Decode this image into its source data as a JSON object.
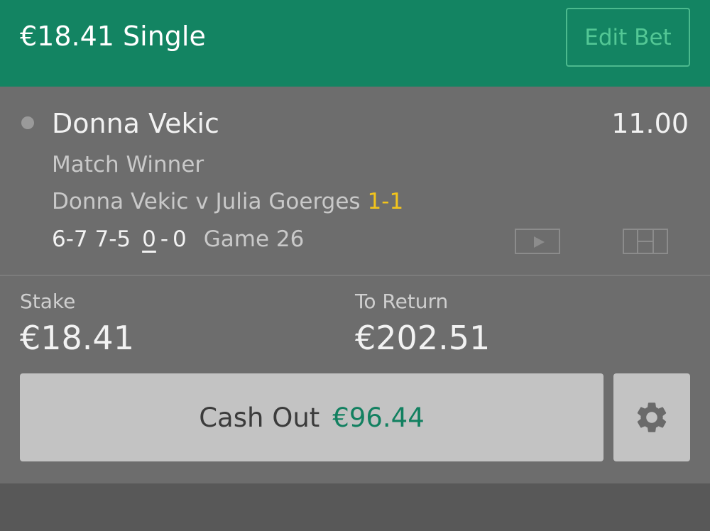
{
  "header": {
    "title": "€18.41 Single",
    "edit_label": "Edit Bet"
  },
  "selection": {
    "name": "Donna Vekic",
    "odds": "11.00",
    "market": "Match Winner",
    "event": "Donna Vekic v Julia Goerges",
    "set_score": "1-1",
    "score": {
      "sets": "6-7 7-5",
      "home_game": "0",
      "separator": "-",
      "away_game": "0",
      "game": "Game 26"
    },
    "icons": [
      "play-video-icon",
      "scoreboard-grid-icon"
    ]
  },
  "stake": {
    "stake_label": "Stake",
    "stake_value": "€18.41",
    "return_label": "To Return",
    "return_value": "€202.51"
  },
  "cashout": {
    "label": "Cash Out",
    "amount": "€96.44",
    "settings_icon": "gear-icon"
  },
  "colors": {
    "header_bg": "#138462",
    "accent_green": "#53c795",
    "cashout_amount": "#128060",
    "set_score_yellow": "#f2c41c",
    "panel_bg": "#6d6d6d"
  }
}
